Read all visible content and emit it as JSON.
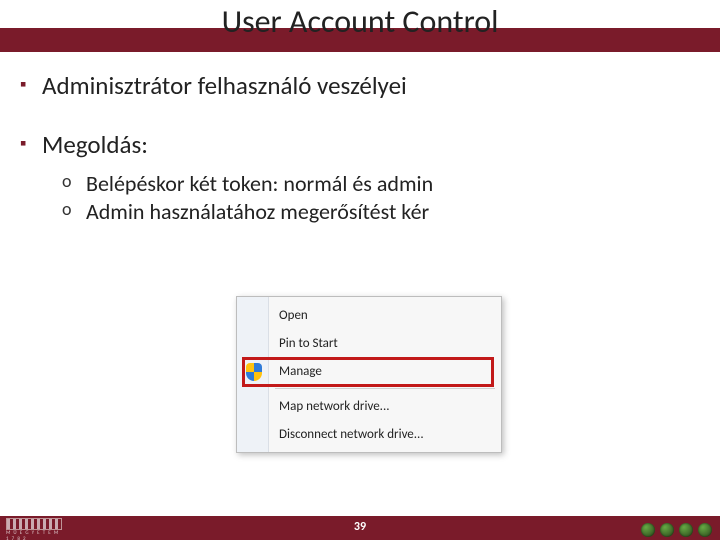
{
  "title": "User Account Control",
  "bullets": {
    "admin": "Adminisztrátor felhasználó veszélyei",
    "solution": "Megoldás:",
    "sub1": "Belépéskor két token: normál és admin",
    "sub2": "Admin használatához megerősítést kér"
  },
  "menu": {
    "open": "Open",
    "pin": "Pin to Start",
    "manage": "Manage",
    "map": "Map network drive...",
    "disconnect": "Disconnect network drive..."
  },
  "footer": {
    "page": "39",
    "org": "M Ű E G Y E T E M  1 7 8 2"
  }
}
